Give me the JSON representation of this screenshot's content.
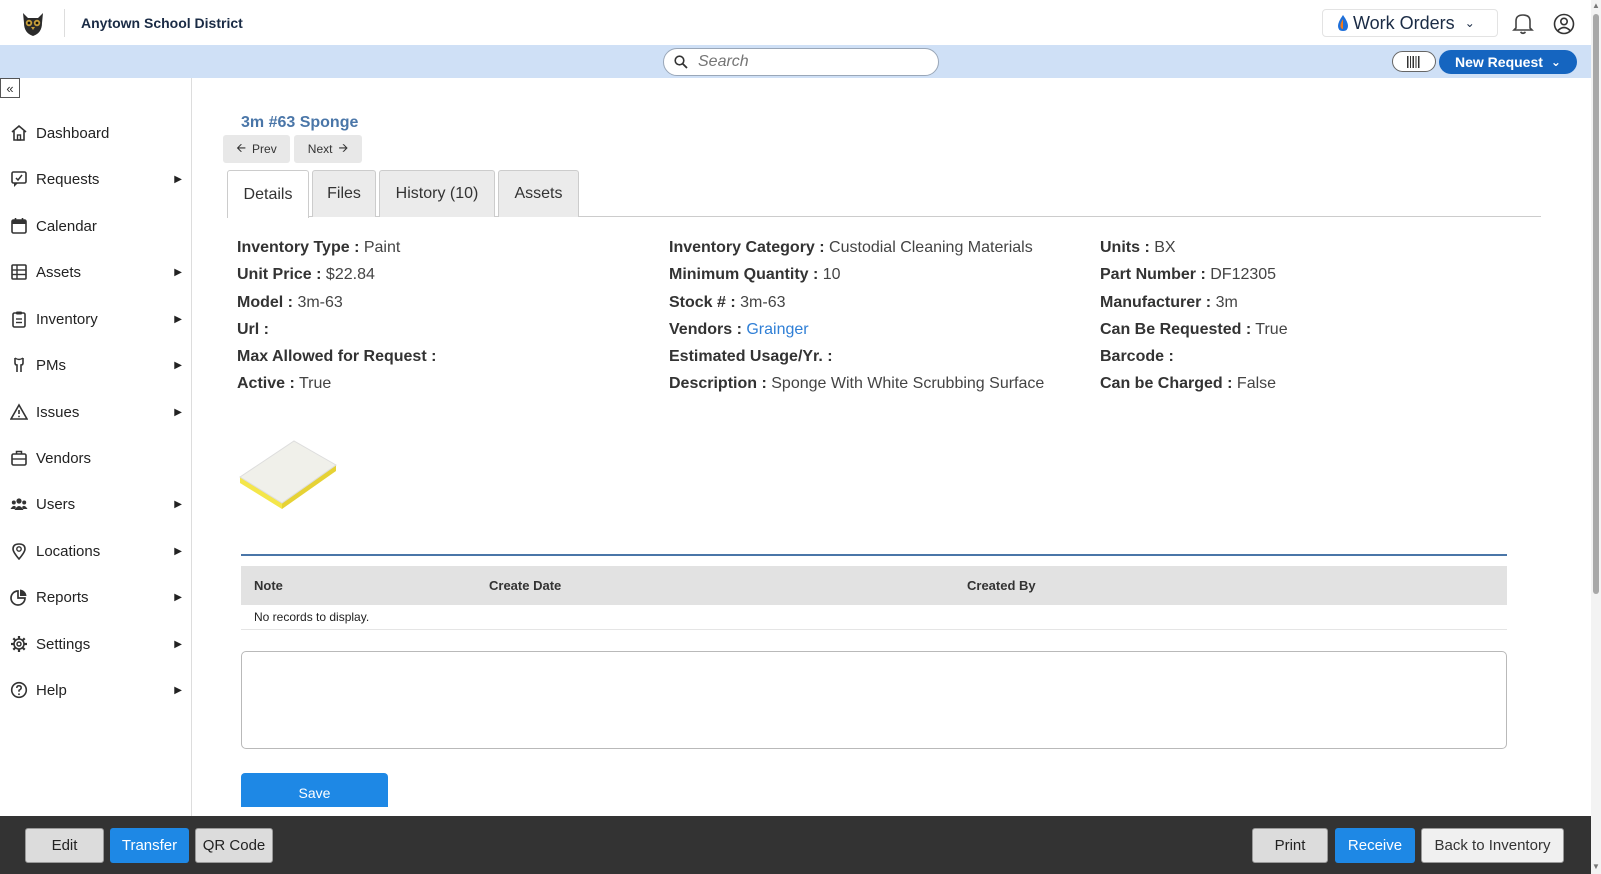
{
  "header": {
    "district_name": "Anytown School District",
    "app_switcher_label": "Work Orders",
    "logo_icon": "owl-mascot-icon",
    "bell_icon": "bell-icon",
    "user_icon": "user-circle-icon",
    "brand_color": "#1565c0"
  },
  "search": {
    "placeholder": "Search"
  },
  "actions": {
    "new_request_label": "New Request",
    "barcode_icon": "barcode-icon"
  },
  "sidebar": {
    "items": [
      {
        "label": "Dashboard",
        "icon": "home-icon",
        "has_submenu": false
      },
      {
        "label": "Requests",
        "icon": "request-icon",
        "has_submenu": true
      },
      {
        "label": "Calendar",
        "icon": "calendar-icon",
        "has_submenu": false
      },
      {
        "label": "Assets",
        "icon": "assets-icon",
        "has_submenu": true
      },
      {
        "label": "Inventory",
        "icon": "clipboard-icon",
        "has_submenu": true
      },
      {
        "label": "PMs",
        "icon": "wrench-icon",
        "has_submenu": true
      },
      {
        "label": "Issues",
        "icon": "warning-icon",
        "has_submenu": true
      },
      {
        "label": "Vendors",
        "icon": "briefcase-icon",
        "has_submenu": false
      },
      {
        "label": "Users",
        "icon": "users-icon",
        "has_submenu": true
      },
      {
        "label": "Locations",
        "icon": "map-pin-icon",
        "has_submenu": true
      },
      {
        "label": "Reports",
        "icon": "pie-chart-icon",
        "has_submenu": true
      },
      {
        "label": "Settings",
        "icon": "gear-icon",
        "has_submenu": true
      },
      {
        "label": "Help",
        "icon": "help-icon",
        "has_submenu": true
      }
    ]
  },
  "item": {
    "title": "3m #63 Sponge",
    "prev_label": "Prev",
    "next_label": "Next"
  },
  "tabs": [
    "Details",
    "Files",
    "History (10)",
    "Assets"
  ],
  "details": {
    "col1": [
      {
        "label": "Inventory Type :",
        "value": "Paint"
      },
      {
        "label": "Unit Price :",
        "value": "$22.84"
      },
      {
        "label": "Model :",
        "value": "3m-63"
      },
      {
        "label": "Url :",
        "value": ""
      },
      {
        "label": "Max Allowed for Request :",
        "value": ""
      },
      {
        "label": "Active :",
        "value": "True"
      }
    ],
    "col2": [
      {
        "label": "Inventory Category :",
        "value": "Custodial Cleaning Materials"
      },
      {
        "label": "Minimum Quantity :",
        "value": "10"
      },
      {
        "label": "Stock # :",
        "value": "3m-63"
      },
      {
        "label": "Vendors :",
        "value": "Grainger",
        "is_link": true
      },
      {
        "label": "Estimated Usage/Yr. :",
        "value": ""
      },
      {
        "label": "Description :",
        "value": "Sponge With White Scrubbing Surface"
      }
    ],
    "col3": [
      {
        "label": "Units :",
        "value": "BX"
      },
      {
        "label": "Part Number :",
        "value": "DF12305"
      },
      {
        "label": "Manufacturer :",
        "value": "3m"
      },
      {
        "label": "Can Be Requested :",
        "value": "True"
      },
      {
        "label": "Barcode :",
        "value": ""
      },
      {
        "label": "Can be Charged :",
        "value": "False"
      }
    ]
  },
  "notes": {
    "columns": [
      "Note",
      "Create Date",
      "Created By"
    ],
    "empty_text": "No records to display.",
    "save_label": "Save"
  },
  "footer": {
    "left_buttons": [
      "Edit",
      "Transfer",
      "QR Code"
    ],
    "right_buttons": [
      "Print",
      "Receive",
      "Back to Inventory"
    ]
  }
}
